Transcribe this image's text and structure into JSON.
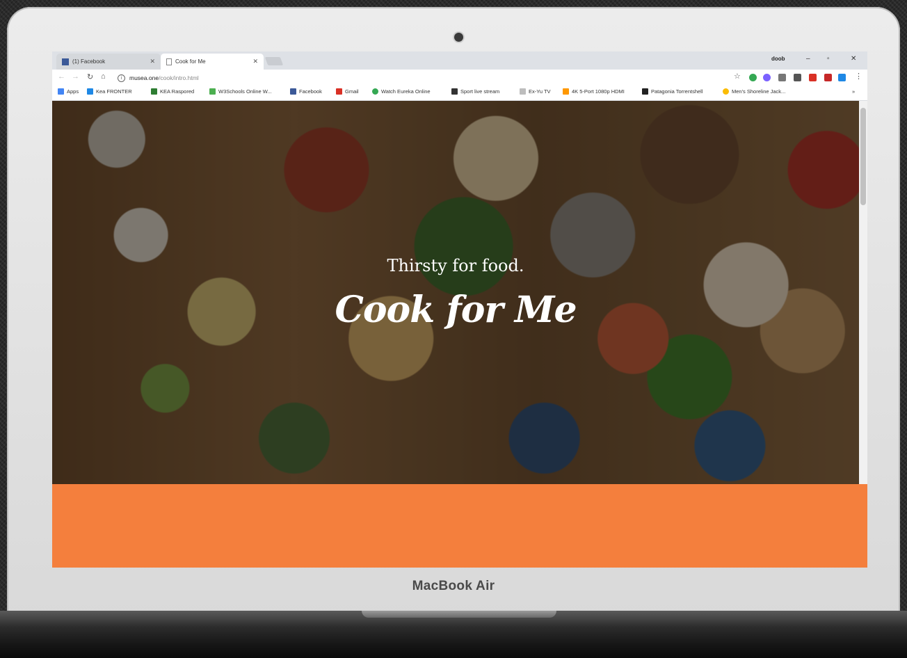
{
  "browser": {
    "tabs": [
      {
        "label": "(1) Facebook",
        "active": false
      },
      {
        "label": "Cook for Me",
        "active": true
      }
    ],
    "user_label": "doob",
    "url": {
      "host": "musea.one",
      "path": "/cook/intro.html"
    },
    "bookmarks": [
      {
        "label": "Apps",
        "color": "#4285f4"
      },
      {
        "label": "Kea FRONTER",
        "color": "#1e88e5"
      },
      {
        "label": "KEA Raspored",
        "color": "#2e7d32"
      },
      {
        "label": "W3Schools Online W...",
        "color": "#4caf50"
      },
      {
        "label": "Facebook",
        "color": "#3b5998"
      },
      {
        "label": "Gmail",
        "color": "#d93025"
      },
      {
        "label": "Watch Eureka Online",
        "color": "#34a853"
      },
      {
        "label": "Sport live stream",
        "color": "#333333"
      },
      {
        "label": "Ex-Yu TV",
        "color": "#9e9e9e"
      },
      {
        "label": "4K 5-Port 1080p HDMI",
        "color": "#ff9800"
      },
      {
        "label": "Patagonia Torrentshell",
        "color": "#222222"
      },
      {
        "label": "Men's Shoreline Jack...",
        "color": "#fbbc04"
      }
    ]
  },
  "hero": {
    "tagline": "Thirsty for food.",
    "title": "Cook for Me"
  },
  "device": {
    "brand": "MacBook Air"
  },
  "colors": {
    "accent_orange": "#f47f3d"
  }
}
